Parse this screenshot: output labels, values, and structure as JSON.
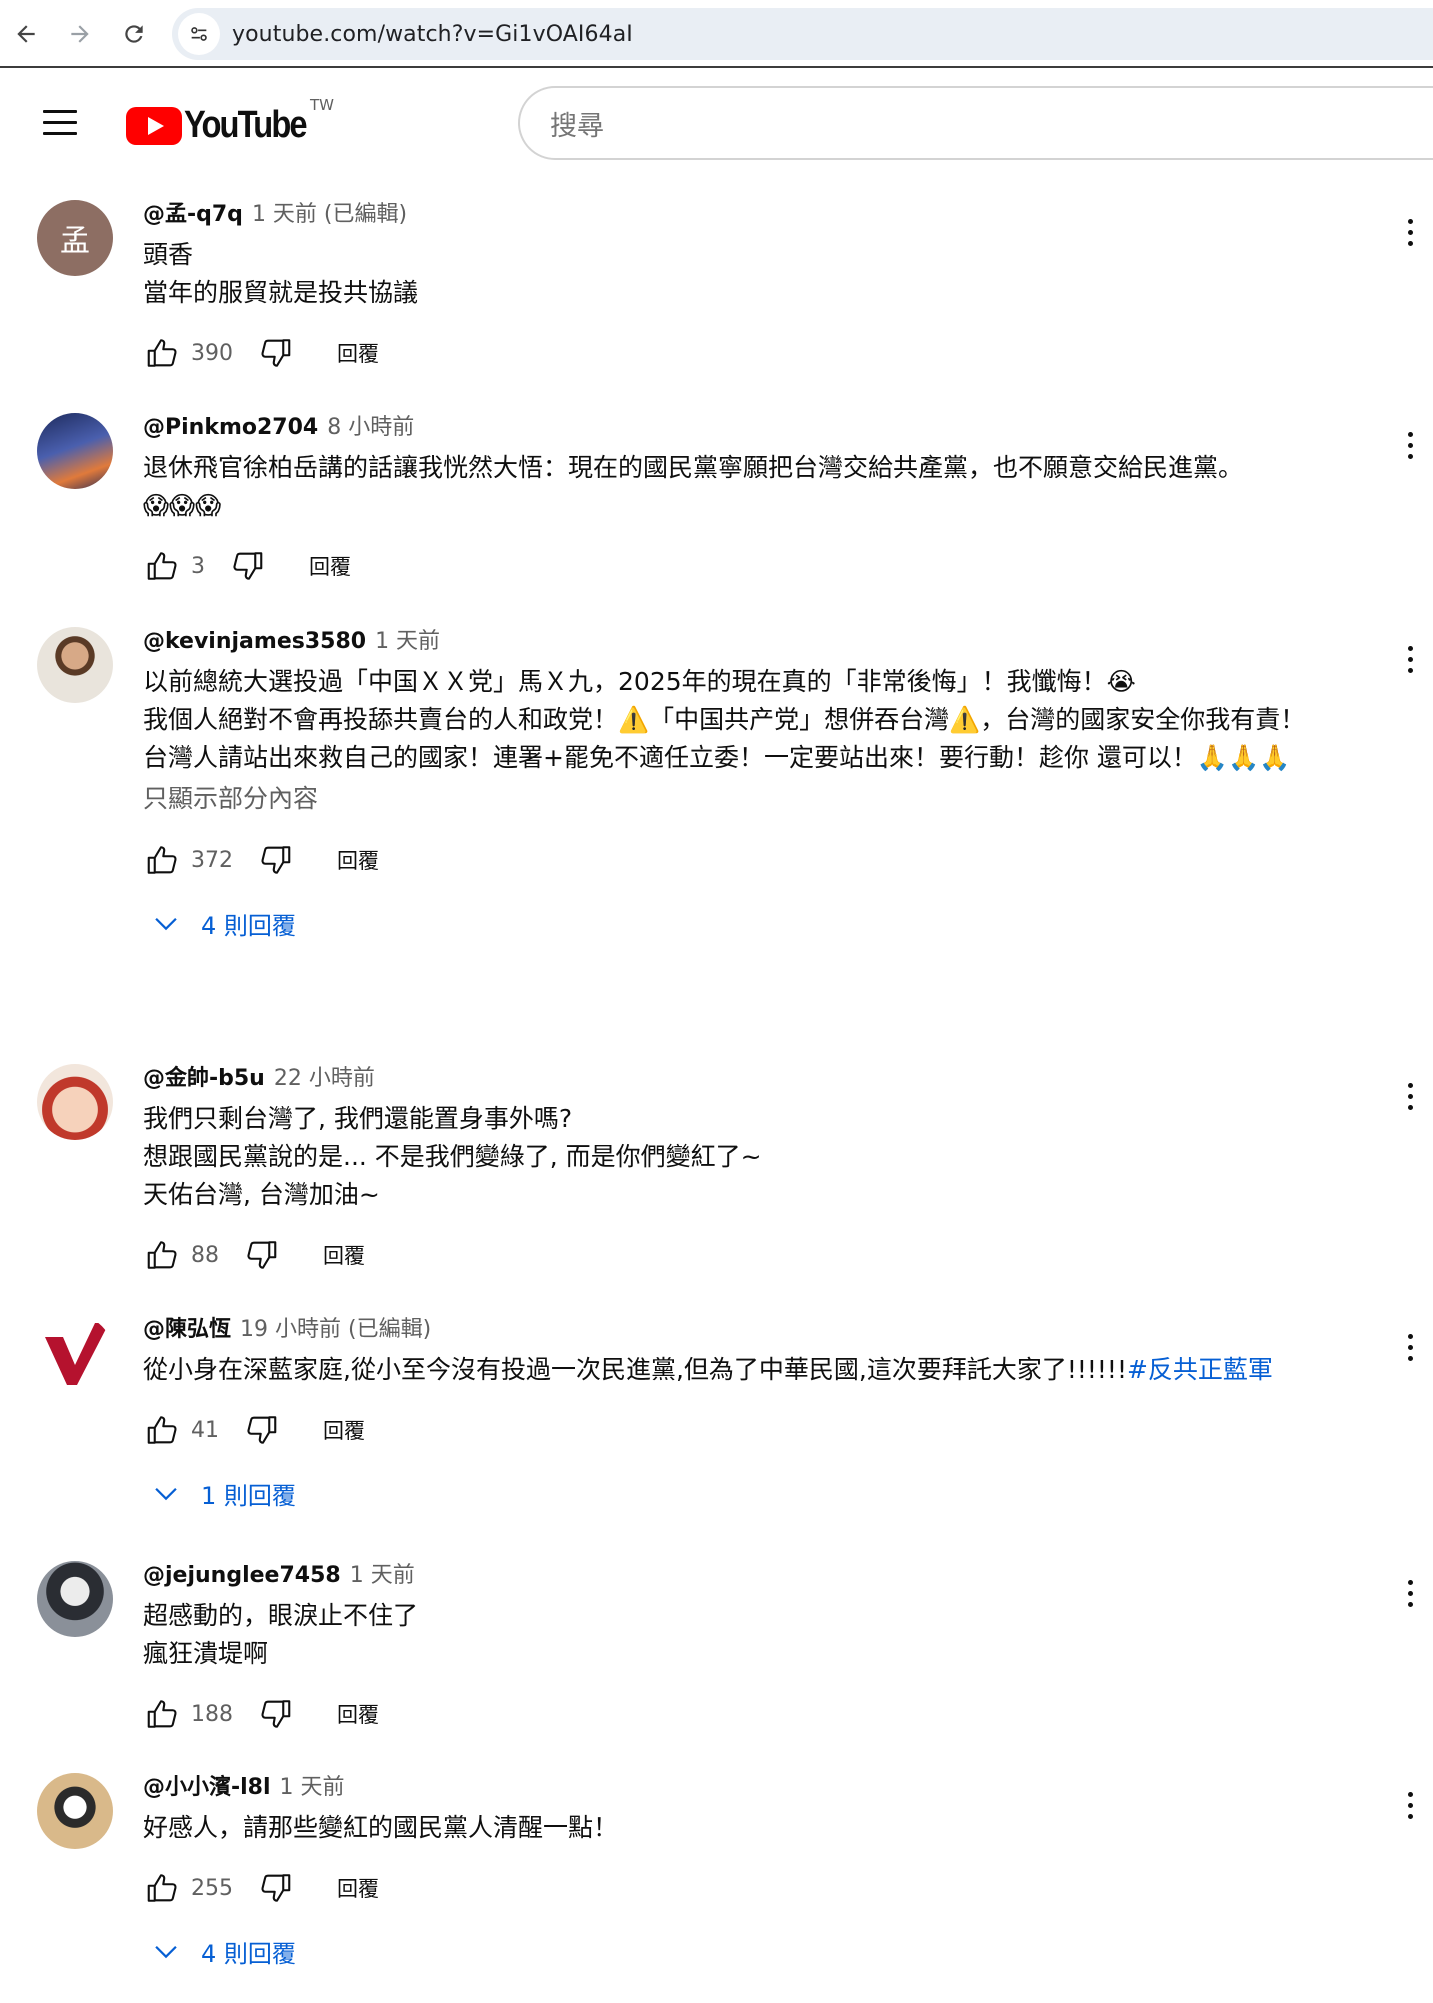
{
  "browser": {
    "url": "youtube.com/watch?v=Gi1vOAI64aI"
  },
  "masthead": {
    "logo_text": "YouTube",
    "country_code": "TW",
    "search_placeholder": "搜尋"
  },
  "colors": {
    "link_blue": "#065fd4",
    "secondary_text": "#606060",
    "yt_red": "#ff0000"
  },
  "comments": [
    {
      "author": "@孟-q7q",
      "time": "1 天前 (已編輯)",
      "avatar_letter": "孟",
      "avatar_color": "#8d6e63",
      "text": "頭香\n當年的服貿就是投共協議",
      "likes": "390",
      "reply_label": "回覆"
    },
    {
      "author": "@Pinkmo2704",
      "time": "8 小時前",
      "avatar_color": "#3d3a6b",
      "text": "退休飛官徐柏岳講的話讓我恍然大悟：現在的國民黨寧願把台灣交給共產黨，也不願意交給民進黨。\n😱😱😱",
      "likes": "3",
      "reply_label": "回覆"
    },
    {
      "author": "@kevinjames3580",
      "time": "1 天前",
      "avatar_color": "#e6e0d8",
      "text": "以前總統大選投過「中国ＸＸ党」馬Ｘ九，2025年的現在真的「非常後悔」！我懺悔！😭\n我個人絕對不會再投舔共賣台的人和政党！⚠️「中国共产党」想併吞台灣⚠️，台灣的國家安全你我有責！\n台灣人請站出來救自己的國家！連署+罷免不適任立委！一定要站出來！要行動！趁你 還可以！🙏🙏🙏",
      "more": "只顯示部分內容",
      "likes": "372",
      "reply_label": "回覆",
      "replies": "4 則回覆"
    },
    {
      "author": "@金帥-b5u",
      "time": "22 小時前",
      "avatar_color": "#f3d6c3",
      "text": "我們只剩台灣了, 我們還能置身事外嗎?\n想跟國民黨說的是... 不是我們變綠了, 而是你們變紅了~\n天佑台灣, 台灣加油~",
      "likes": "88",
      "reply_label": "回覆"
    },
    {
      "author": "@陳弘恆",
      "time": "19 小時前 (已編輯)",
      "avatar_color": "#ffffff",
      "text": "從小身在深藍家庭,從小至今沒有投過一次民進黨,但為了中華民國,這次要拜託大家了!!!!!!",
      "hashtag": "#反共正藍軍",
      "likes": "41",
      "reply_label": "回覆",
      "replies": "1 則回覆"
    },
    {
      "author": "@jejunglee7458",
      "time": "1 天前",
      "avatar_color": "#c9ccd1",
      "text": "超感動的，眼淚止不住了\n瘋狂潰堤啊",
      "likes": "188",
      "reply_label": "回覆"
    },
    {
      "author": "@小小濱-l8l",
      "time": "1 天前",
      "avatar_color": "#d9b98a",
      "text": "好感人，請那些變紅的國民黨人清醒一點！",
      "likes": "255",
      "reply_label": "回覆",
      "replies": "4 則回覆"
    }
  ]
}
